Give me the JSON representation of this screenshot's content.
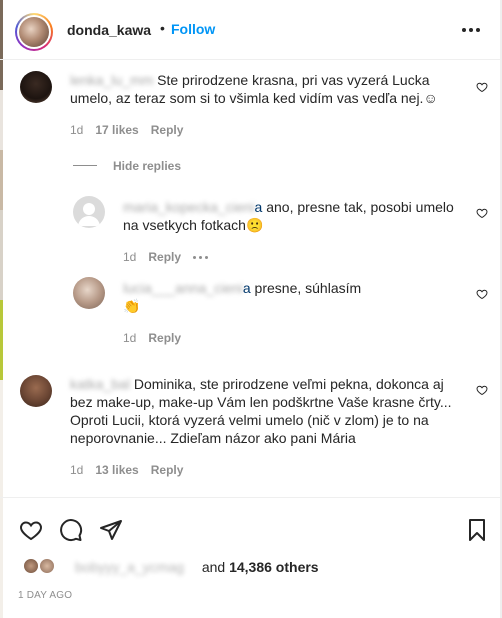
{
  "header": {
    "username": "donda_kawa",
    "separator": "•",
    "follow_label": "Follow",
    "more_icon": "more-horizontal-icon"
  },
  "comments": [
    {
      "author": "",
      "text": "Ste prirodzene krasna, pri vas vyzerá Lucka umelo, az teraz som si to všimla ked vidím vas vedľa nej.☺",
      "time": "1d",
      "likes": "17 likes",
      "reply_label": "Reply"
    },
    {
      "hide_replies_label": "Hide replies"
    },
    {
      "author": "",
      "mention": "a",
      "text": " ano, presne tak, posobi umelo na vsetkych fotkach",
      "emoji": "🙁",
      "time": "1d",
      "reply_label": "Reply"
    },
    {
      "author": "",
      "mention": "a",
      "text": " presne, súhlasím",
      "emoji": "👏",
      "time": "1d",
      "reply_label": "Reply"
    },
    {
      "author": "",
      "text": "Dominika, ste prirodzene veľmi pekna, dokonca aj bez make-up, make-up Vám len podškrtne Vaše krasne črty... Oproti Lucii, ktorá vyzerá velmi umelo (nič v zlom) je to na neporovnanie... Zdieľam názor ako pani Mária",
      "time": "1d",
      "likes": "13 likes",
      "reply_label": "Reply"
    }
  ],
  "actions": {
    "like_icon": "heart-icon",
    "comment_icon": "comment-icon",
    "share_icon": "send-icon",
    "save_icon": "bookmark-icon"
  },
  "likes": {
    "and_text": "and",
    "others": "14,386 others"
  },
  "date": "1 DAY AGO",
  "colors": {
    "accent": "#0095f6",
    "text": "#262626",
    "secondary": "#8e8e8e",
    "mention": "#00376b"
  }
}
